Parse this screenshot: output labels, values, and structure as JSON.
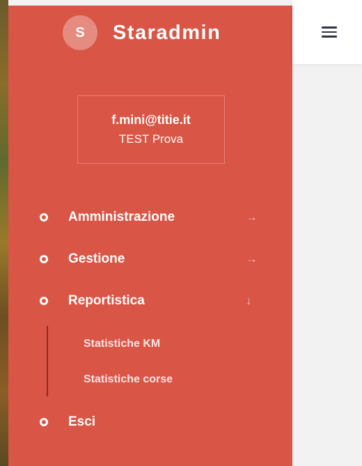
{
  "brand": {
    "logo_letter": "S",
    "name": "Staradmin"
  },
  "user": {
    "email": "f.mini@titie.it",
    "name": "TEST Prova"
  },
  "nav": {
    "items": [
      {
        "label": "Amministrazione",
        "arrow": "→",
        "icon": "arrow-right-icon"
      },
      {
        "label": "Gestione",
        "arrow": "→",
        "icon": "arrow-right-icon"
      },
      {
        "label": "Reportistica",
        "arrow": "↓",
        "icon": "arrow-down-icon"
      },
      {
        "label": "Esci"
      }
    ],
    "submenu": [
      {
        "label": "Statistiche KM"
      },
      {
        "label": "Statistiche corse"
      }
    ]
  },
  "topbar": {
    "menu_icon": "hamburger-menu-icon"
  },
  "colors": {
    "sidebar": "#d95545",
    "content_bg": "#f2f2f2",
    "topbar": "#ffffff",
    "submenu_line": "#8c2b22"
  }
}
